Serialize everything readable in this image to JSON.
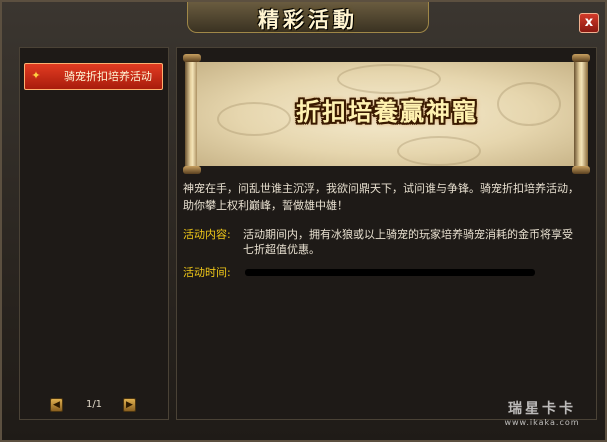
{
  "window": {
    "title": "精彩活動",
    "close_label": "x"
  },
  "sidebar": {
    "items": [
      {
        "label": "骑宠折扣培养活动",
        "icon": "sparkle-icon",
        "selected": true
      }
    ],
    "pager": {
      "text": "1/1"
    }
  },
  "banner": {
    "text": "折扣培養贏神寵"
  },
  "content": {
    "description": "神宠在手，问乱世谁主沉浮，我欲问鼎天下，试问谁与争锋。骑宠折扣培养活动，助你攀上权利巅峰，誓做雄中雄！",
    "details": [
      {
        "label": "活动内容:",
        "value": "活动期间内，拥有冰狼或以上骑宠的玩家培养骑宠消耗的金币将享受七折超值优惠。"
      },
      {
        "label": "活动时间:",
        "value": ""
      }
    ]
  },
  "watermark": {
    "logo": "瑞星卡卡",
    "url": "www.ikaka.com"
  },
  "colors": {
    "accent": "#f0c818",
    "tab_active": "#d42c18",
    "close": "#c0301e"
  }
}
